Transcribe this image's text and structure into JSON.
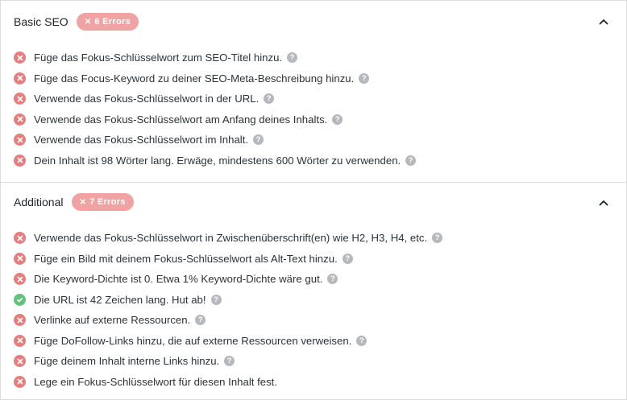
{
  "colors": {
    "error": "#e67e7e",
    "success": "#62c37d",
    "badge": "#f1a3a3",
    "help": "#b5b9be",
    "border": "#dcdcde"
  },
  "icons": {
    "error": "x-circle-icon",
    "success": "check-circle-icon",
    "help": "question-circle-icon",
    "collapse": "chevron-up-icon",
    "badge": "x-icon"
  },
  "help_symbol": "?",
  "basic_seo": {
    "title": "Basic SEO",
    "badge_icon": "✕",
    "badge_label": "6 Errors",
    "items": [
      {
        "status": "error",
        "text": "Füge das Fokus-Schlüsselwort zum SEO-Titel hinzu.",
        "help": true
      },
      {
        "status": "error",
        "text": "Füge das Focus-Keyword zu deiner SEO-Meta-Beschreibung hinzu.",
        "help": true
      },
      {
        "status": "error",
        "text": "Verwende das Fokus-Schlüsselwort in der URL.",
        "help": true
      },
      {
        "status": "error",
        "text": "Verwende das Fokus-Schlüsselwort am Anfang deines Inhalts.",
        "help": true
      },
      {
        "status": "error",
        "text": "Verwende das Fokus-Schlüsselwort im Inhalt.",
        "help": true
      },
      {
        "status": "error",
        "text": "Dein Inhalt ist 98 Wörter lang. Erwäge, mindestens 600 Wörter zu verwenden.",
        "help": true
      }
    ]
  },
  "additional": {
    "title": "Additional",
    "badge_icon": "✕",
    "badge_label": "7 Errors",
    "items": [
      {
        "status": "error",
        "text": "Verwende das Fokus-Schlüsselwort in Zwischenüberschrift(en) wie H2, H3, H4, etc.",
        "help": true
      },
      {
        "status": "error",
        "text": "Füge ein Bild mit deinem Fokus-Schlüsselwort als Alt-Text hinzu.",
        "help": true
      },
      {
        "status": "error",
        "text": "Die Keyword-Dichte ist 0. Etwa 1% Keyword-Dichte wäre gut.",
        "help": true
      },
      {
        "status": "success",
        "text": "Die URL ist 42 Zeichen lang. Hut ab!",
        "help": true
      },
      {
        "status": "error",
        "text": "Verlinke auf externe Ressourcen.",
        "help": true
      },
      {
        "status": "error",
        "text": "Füge DoFollow-Links hinzu, die auf externe Ressourcen verweisen.",
        "help": true
      },
      {
        "status": "error",
        "text": "Füge deinem Inhalt interne Links hinzu.",
        "help": true
      },
      {
        "status": "error",
        "text": "Lege ein Fokus-Schlüsselwort für diesen Inhalt fest.",
        "help": false
      }
    ]
  }
}
